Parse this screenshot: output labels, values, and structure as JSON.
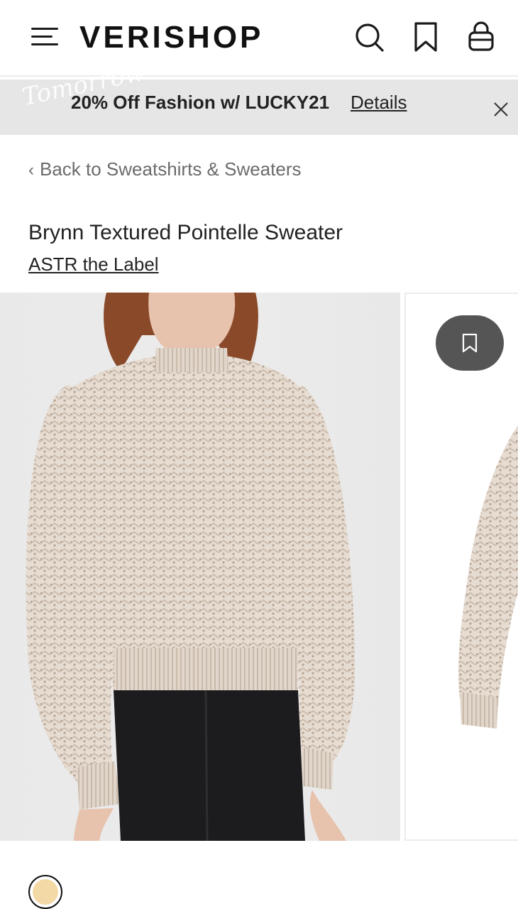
{
  "header": {
    "logo": "VERISHOP",
    "menu_icon": "hamburger-menu-icon",
    "search_icon": "search-icon",
    "saved_icon": "bookmark-icon",
    "bag_icon": "shopping-bag-icon"
  },
  "promo": {
    "text": "20% Off Fashion w/ LUCKY21",
    "details_label": "Details",
    "close_icon": "close-icon"
  },
  "breadcrumb": {
    "chevron": "‹",
    "label": "Back to Sweatshirts & Sweaters"
  },
  "product": {
    "title": "Brynn Textured Pointelle Sweater",
    "brand": "ASTR the Label",
    "images": [
      {
        "alt_icon": "product-photo-front"
      },
      {
        "alt_icon": "product-photo-side"
      }
    ],
    "wishlist_icon": "bookmark-icon"
  },
  "swatches": {
    "selected_color": "#f3d9a6"
  },
  "colors": {
    "banner_bg": "#e6e6e6",
    "fab_bg": "#555555",
    "text_primary": "#222222",
    "text_secondary": "#6b6b6b"
  }
}
